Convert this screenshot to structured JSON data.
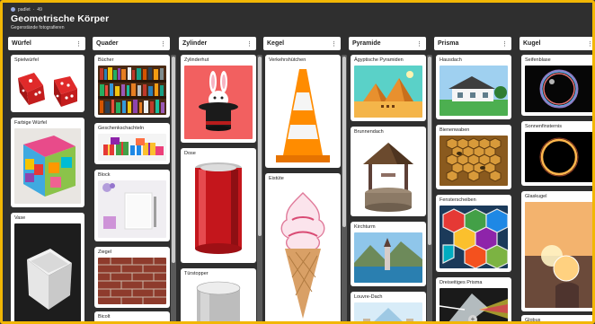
{
  "app": {
    "brand": "padlet",
    "brand_suffix": "49",
    "title": "Geometrische Körper",
    "subtitle": "Gegenstände fotografieren"
  },
  "colors": {
    "frame": "#f2b705",
    "board_bg": "#2f2f2f",
    "column_header": "#ffffff"
  },
  "icons": {
    "more": "⋮",
    "add": "+"
  },
  "columns": [
    {
      "title": "Würfel",
      "cards": [
        "Spielwürfel",
        "Farbige Würfel",
        "Vase"
      ]
    },
    {
      "title": "Quader",
      "cards": [
        "Bücher",
        "Geschenkschachteln",
        "Block",
        "Ziegel",
        "Bicolt"
      ]
    },
    {
      "title": "Zylinder",
      "cards": [
        "Zylinderhut",
        "Dose",
        "Türstopper"
      ]
    },
    {
      "title": "Kegel",
      "cards": [
        "Verkehrshütchen",
        "Eistüte"
      ]
    },
    {
      "title": "Pyramide",
      "cards": [
        "Ägyptische Pyramiden",
        "Brunnendach",
        "Kirchturm",
        "Louvre-Dach"
      ]
    },
    {
      "title": "Prisma",
      "cards": [
        "Hausdach",
        "Bienenwaben",
        "Fensterscheiben",
        "Dreiseitiges Prisma"
      ]
    },
    {
      "title": "Kugel",
      "cards": [
        "Seifenblase",
        "Sonnenfinsternis",
        "Glaskugel",
        "Globus"
      ]
    }
  ]
}
